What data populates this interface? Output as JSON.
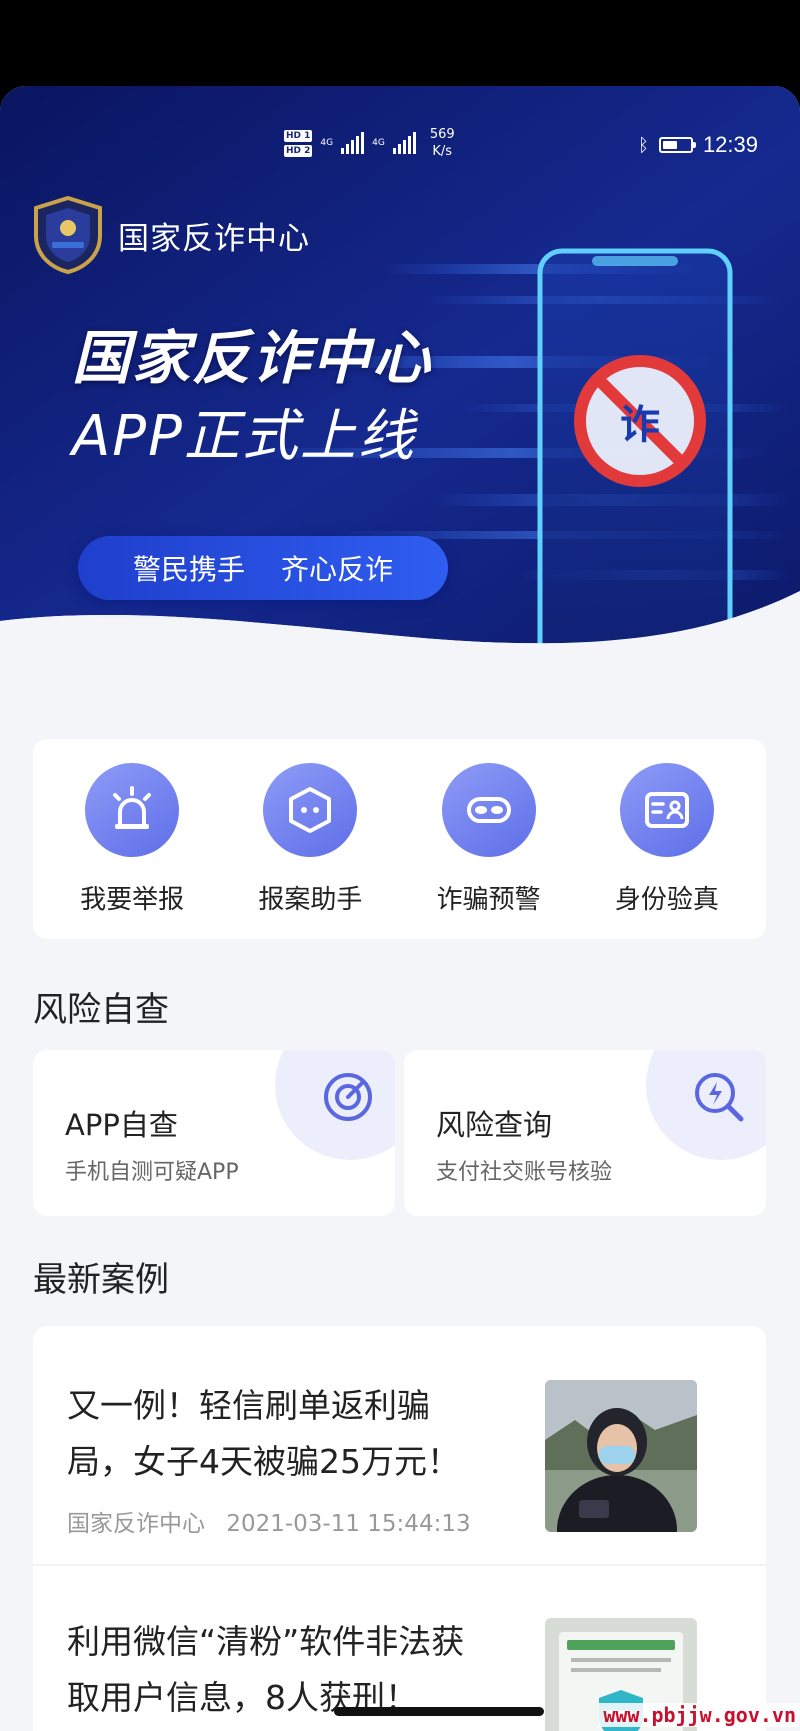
{
  "status_bar": {
    "hd1": "HD 1",
    "hd2": "HD 2",
    "net1": "4G",
    "net2": "4G",
    "speed_value": "569",
    "speed_unit": "K/s",
    "time": "12:39",
    "battery_fill": 0.55,
    "bluetooth_icon": "bluetooth-icon"
  },
  "banner": {
    "app_name": "国家反诈中心",
    "headline": "国家反诈中心",
    "subheadline": "APP正式上线",
    "slogan_left": "警民携手",
    "slogan_right": "齐心反诈",
    "phone_badge_char": "诈",
    "colors": {
      "deep": "#0b1a6e",
      "mid": "#1f3bb0",
      "accent": "#3c7bff"
    }
  },
  "quick_actions": [
    {
      "label": "我要举报",
      "icon": "alarm-light-icon"
    },
    {
      "label": "报案助手",
      "icon": "robot-face-icon"
    },
    {
      "label": "诈骗预警",
      "icon": "mask-icon"
    },
    {
      "label": "身份验真",
      "icon": "id-card-icon"
    }
  ],
  "risk_check": {
    "section_title": "风险自查",
    "cards": [
      {
        "title": "APP自查",
        "subtitle": "手机自测可疑APP",
        "icon": "target-scan-icon"
      },
      {
        "title": "风险查询",
        "subtitle": "支付社交账号核验",
        "icon": "search-lightning-icon"
      }
    ]
  },
  "latest_cases": {
    "section_title": "最新案例",
    "items": [
      {
        "title": "又一例！轻信刷单返利骗局，女子4天被骗25万元！",
        "source": "国家反诈中心",
        "timestamp": "2021-03-11 15:44:13",
        "thumb": "photo-woman-mask"
      },
      {
        "title": "利用微信“清粉”软件非法获取用户信息，8人获刑！",
        "thumb": "photo-document-shield"
      }
    ]
  },
  "watermark": "www.pbjjw.gov.vn"
}
